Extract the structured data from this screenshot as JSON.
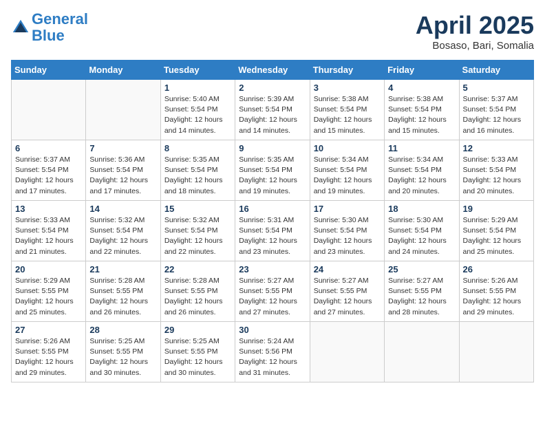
{
  "logo": {
    "line1": "General",
    "line2": "Blue"
  },
  "title": "April 2025",
  "subtitle": "Bosaso, Bari, Somalia",
  "days_of_week": [
    "Sunday",
    "Monday",
    "Tuesday",
    "Wednesday",
    "Thursday",
    "Friday",
    "Saturday"
  ],
  "weeks": [
    [
      {
        "day": "",
        "sunrise": "",
        "sunset": "",
        "daylight": ""
      },
      {
        "day": "",
        "sunrise": "",
        "sunset": "",
        "daylight": ""
      },
      {
        "day": "1",
        "sunrise": "Sunrise: 5:40 AM",
        "sunset": "Sunset: 5:54 PM",
        "daylight": "Daylight: 12 hours and 14 minutes."
      },
      {
        "day": "2",
        "sunrise": "Sunrise: 5:39 AM",
        "sunset": "Sunset: 5:54 PM",
        "daylight": "Daylight: 12 hours and 14 minutes."
      },
      {
        "day": "3",
        "sunrise": "Sunrise: 5:38 AM",
        "sunset": "Sunset: 5:54 PM",
        "daylight": "Daylight: 12 hours and 15 minutes."
      },
      {
        "day": "4",
        "sunrise": "Sunrise: 5:38 AM",
        "sunset": "Sunset: 5:54 PM",
        "daylight": "Daylight: 12 hours and 15 minutes."
      },
      {
        "day": "5",
        "sunrise": "Sunrise: 5:37 AM",
        "sunset": "Sunset: 5:54 PM",
        "daylight": "Daylight: 12 hours and 16 minutes."
      }
    ],
    [
      {
        "day": "6",
        "sunrise": "Sunrise: 5:37 AM",
        "sunset": "Sunset: 5:54 PM",
        "daylight": "Daylight: 12 hours and 17 minutes."
      },
      {
        "day": "7",
        "sunrise": "Sunrise: 5:36 AM",
        "sunset": "Sunset: 5:54 PM",
        "daylight": "Daylight: 12 hours and 17 minutes."
      },
      {
        "day": "8",
        "sunrise": "Sunrise: 5:35 AM",
        "sunset": "Sunset: 5:54 PM",
        "daylight": "Daylight: 12 hours and 18 minutes."
      },
      {
        "day": "9",
        "sunrise": "Sunrise: 5:35 AM",
        "sunset": "Sunset: 5:54 PM",
        "daylight": "Daylight: 12 hours and 19 minutes."
      },
      {
        "day": "10",
        "sunrise": "Sunrise: 5:34 AM",
        "sunset": "Sunset: 5:54 PM",
        "daylight": "Daylight: 12 hours and 19 minutes."
      },
      {
        "day": "11",
        "sunrise": "Sunrise: 5:34 AM",
        "sunset": "Sunset: 5:54 PM",
        "daylight": "Daylight: 12 hours and 20 minutes."
      },
      {
        "day": "12",
        "sunrise": "Sunrise: 5:33 AM",
        "sunset": "Sunset: 5:54 PM",
        "daylight": "Daylight: 12 hours and 20 minutes."
      }
    ],
    [
      {
        "day": "13",
        "sunrise": "Sunrise: 5:33 AM",
        "sunset": "Sunset: 5:54 PM",
        "daylight": "Daylight: 12 hours and 21 minutes."
      },
      {
        "day": "14",
        "sunrise": "Sunrise: 5:32 AM",
        "sunset": "Sunset: 5:54 PM",
        "daylight": "Daylight: 12 hours and 22 minutes."
      },
      {
        "day": "15",
        "sunrise": "Sunrise: 5:32 AM",
        "sunset": "Sunset: 5:54 PM",
        "daylight": "Daylight: 12 hours and 22 minutes."
      },
      {
        "day": "16",
        "sunrise": "Sunrise: 5:31 AM",
        "sunset": "Sunset: 5:54 PM",
        "daylight": "Daylight: 12 hours and 23 minutes."
      },
      {
        "day": "17",
        "sunrise": "Sunrise: 5:30 AM",
        "sunset": "Sunset: 5:54 PM",
        "daylight": "Daylight: 12 hours and 23 minutes."
      },
      {
        "day": "18",
        "sunrise": "Sunrise: 5:30 AM",
        "sunset": "Sunset: 5:54 PM",
        "daylight": "Daylight: 12 hours and 24 minutes."
      },
      {
        "day": "19",
        "sunrise": "Sunrise: 5:29 AM",
        "sunset": "Sunset: 5:54 PM",
        "daylight": "Daylight: 12 hours and 25 minutes."
      }
    ],
    [
      {
        "day": "20",
        "sunrise": "Sunrise: 5:29 AM",
        "sunset": "Sunset: 5:55 PM",
        "daylight": "Daylight: 12 hours and 25 minutes."
      },
      {
        "day": "21",
        "sunrise": "Sunrise: 5:28 AM",
        "sunset": "Sunset: 5:55 PM",
        "daylight": "Daylight: 12 hours and 26 minutes."
      },
      {
        "day": "22",
        "sunrise": "Sunrise: 5:28 AM",
        "sunset": "Sunset: 5:55 PM",
        "daylight": "Daylight: 12 hours and 26 minutes."
      },
      {
        "day": "23",
        "sunrise": "Sunrise: 5:27 AM",
        "sunset": "Sunset: 5:55 PM",
        "daylight": "Daylight: 12 hours and 27 minutes."
      },
      {
        "day": "24",
        "sunrise": "Sunrise: 5:27 AM",
        "sunset": "Sunset: 5:55 PM",
        "daylight": "Daylight: 12 hours and 27 minutes."
      },
      {
        "day": "25",
        "sunrise": "Sunrise: 5:27 AM",
        "sunset": "Sunset: 5:55 PM",
        "daylight": "Daylight: 12 hours and 28 minutes."
      },
      {
        "day": "26",
        "sunrise": "Sunrise: 5:26 AM",
        "sunset": "Sunset: 5:55 PM",
        "daylight": "Daylight: 12 hours and 29 minutes."
      }
    ],
    [
      {
        "day": "27",
        "sunrise": "Sunrise: 5:26 AM",
        "sunset": "Sunset: 5:55 PM",
        "daylight": "Daylight: 12 hours and 29 minutes."
      },
      {
        "day": "28",
        "sunrise": "Sunrise: 5:25 AM",
        "sunset": "Sunset: 5:55 PM",
        "daylight": "Daylight: 12 hours and 30 minutes."
      },
      {
        "day": "29",
        "sunrise": "Sunrise: 5:25 AM",
        "sunset": "Sunset: 5:55 PM",
        "daylight": "Daylight: 12 hours and 30 minutes."
      },
      {
        "day": "30",
        "sunrise": "Sunrise: 5:24 AM",
        "sunset": "Sunset: 5:56 PM",
        "daylight": "Daylight: 12 hours and 31 minutes."
      },
      {
        "day": "",
        "sunrise": "",
        "sunset": "",
        "daylight": ""
      },
      {
        "day": "",
        "sunrise": "",
        "sunset": "",
        "daylight": ""
      },
      {
        "day": "",
        "sunrise": "",
        "sunset": "",
        "daylight": ""
      }
    ]
  ]
}
